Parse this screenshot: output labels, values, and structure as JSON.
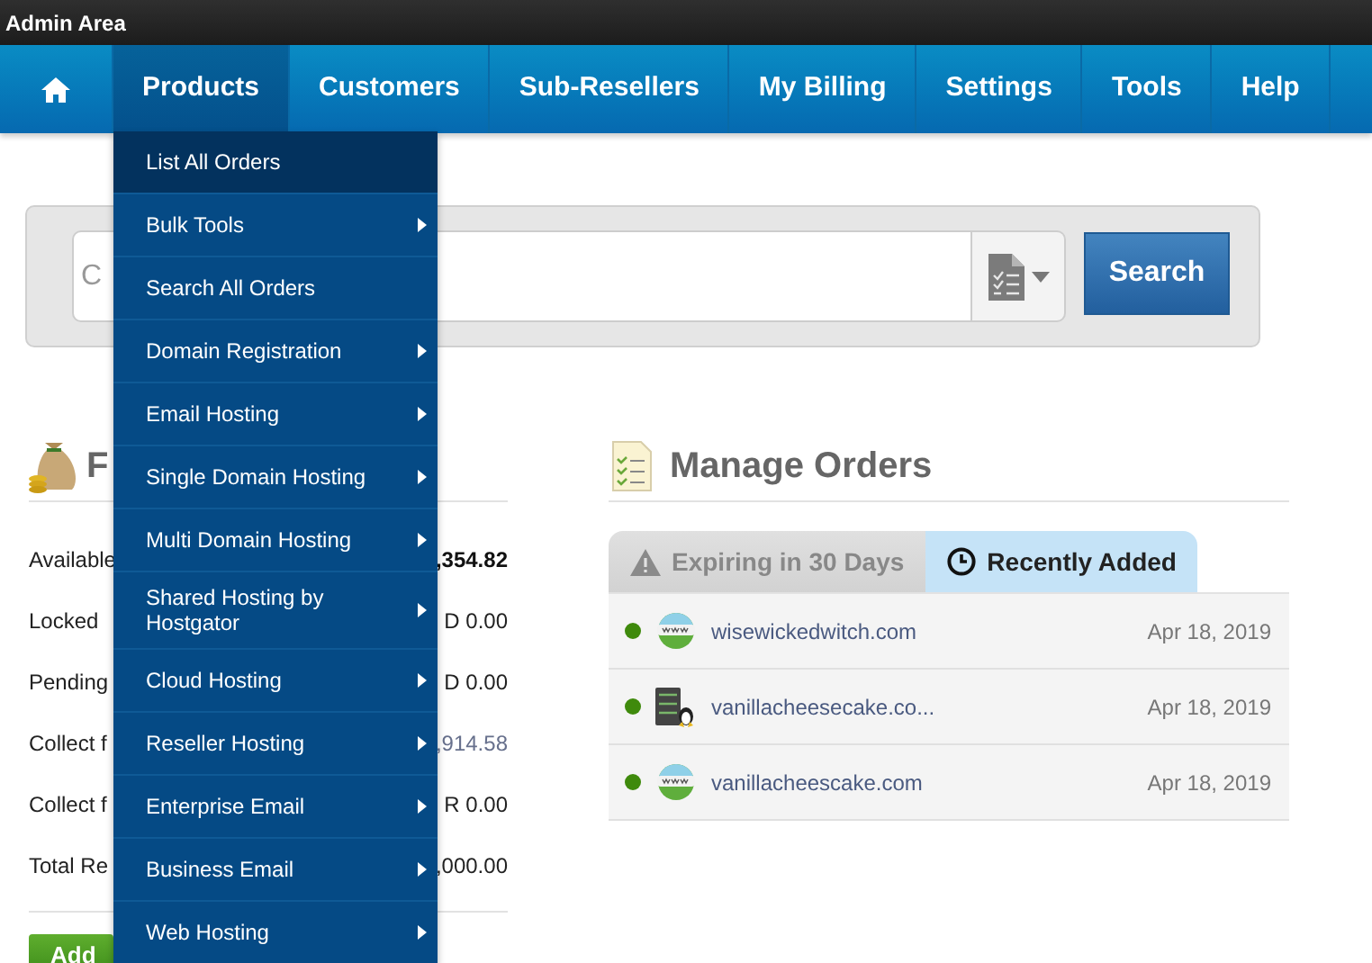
{
  "top_bar": {
    "title": "Admin Area"
  },
  "nav": {
    "items": [
      {
        "kind": "home",
        "selected": false
      },
      {
        "kind": "text",
        "label": "Products",
        "selected": true
      },
      {
        "kind": "text",
        "label": "Customers",
        "selected": false
      },
      {
        "kind": "text",
        "label": "Sub-Resellers",
        "selected": false
      },
      {
        "kind": "text",
        "label": "My Billing",
        "selected": false
      },
      {
        "kind": "text",
        "label": "Settings",
        "selected": false
      },
      {
        "kind": "text",
        "label": "Tools",
        "selected": false
      },
      {
        "kind": "text",
        "label": "Help",
        "selected": false
      }
    ]
  },
  "products_menu": [
    {
      "label": "List All Orders",
      "selected": true,
      "submenu": false
    },
    {
      "label": "Bulk Tools",
      "selected": false,
      "submenu": true
    },
    {
      "label": "Search All Orders",
      "selected": false,
      "submenu": false
    },
    {
      "label": "Domain Registration",
      "selected": false,
      "submenu": true
    },
    {
      "label": "Email Hosting",
      "selected": false,
      "submenu": true
    },
    {
      "label": "Single Domain Hosting",
      "selected": false,
      "submenu": true
    },
    {
      "label": "Multi Domain Hosting",
      "selected": false,
      "submenu": true
    },
    {
      "label": "Shared Hosting by Hostgator",
      "selected": false,
      "submenu": true
    },
    {
      "label": "Cloud Hosting",
      "selected": false,
      "submenu": true
    },
    {
      "label": "Reseller Hosting",
      "selected": false,
      "submenu": true
    },
    {
      "label": "Enterprise Email",
      "selected": false,
      "submenu": true
    },
    {
      "label": "Business Email",
      "selected": false,
      "submenu": true
    },
    {
      "label": "Web Hosting",
      "selected": false,
      "submenu": true
    }
  ],
  "search": {
    "placeholder": "C",
    "button": "Search"
  },
  "funds": {
    "heading": "F",
    "rows": [
      {
        "label": "Available",
        "value": ",354.82",
        "kind": "bold"
      },
      {
        "label": "Locked",
        "value": "D 0.00",
        "kind": "plain"
      },
      {
        "label": "Pending",
        "value": "D 0.00",
        "kind": "plain"
      },
      {
        "label": "Collect f",
        "value": ",914.58",
        "kind": "link"
      },
      {
        "label": "Collect f",
        "value": "R 0.00",
        "kind": "plain"
      },
      {
        "label": "Total Re",
        "value": ",000.00",
        "kind": "plain"
      }
    ],
    "button": "Add"
  },
  "manage_orders": {
    "heading": "Manage Orders",
    "tabs": [
      {
        "kind": "warning",
        "label": "Expiring in 30 Days",
        "selected": false
      },
      {
        "kind": "clock",
        "label": "Recently Added",
        "selected": true
      }
    ],
    "rows": [
      {
        "kind": "domain",
        "name": "wisewickedwitch.com",
        "date": "Apr 18, 2019"
      },
      {
        "kind": "server",
        "name": "vanillacheesecake.co...",
        "date": "Apr 18, 2019"
      },
      {
        "kind": "domain",
        "name": "vanillacheescake.com",
        "date": "Apr 18, 2019"
      }
    ]
  }
}
